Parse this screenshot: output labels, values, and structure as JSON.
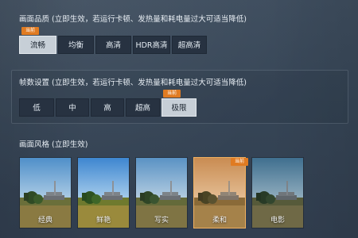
{
  "quality": {
    "title": "画面品质 (立即生效，若运行卡顿、发热量和耗电量过大可适当降低)",
    "options": [
      "流畅",
      "均衡",
      "高清",
      "HDR高清",
      "超高清"
    ],
    "selected": "流畅",
    "current_tag": "当前"
  },
  "framerate": {
    "title": "帧数设置 (立即生效，若运行卡顿、发热量和耗电量过大可适当降低)",
    "options": [
      "低",
      "中",
      "高",
      "超高",
      "极限"
    ],
    "selected": "极限",
    "current_tag": "当前"
  },
  "style": {
    "title": "画面风格 (立即生效)",
    "options": [
      "经典",
      "鲜艳",
      "写实",
      "柔和",
      "电影"
    ],
    "selected": "柔和",
    "current_tag": "当前"
  },
  "colors": {
    "accent": "#e07b22",
    "selected_bg": "#c7cfd7",
    "button_bg": "#273241",
    "background": "#364556"
  }
}
